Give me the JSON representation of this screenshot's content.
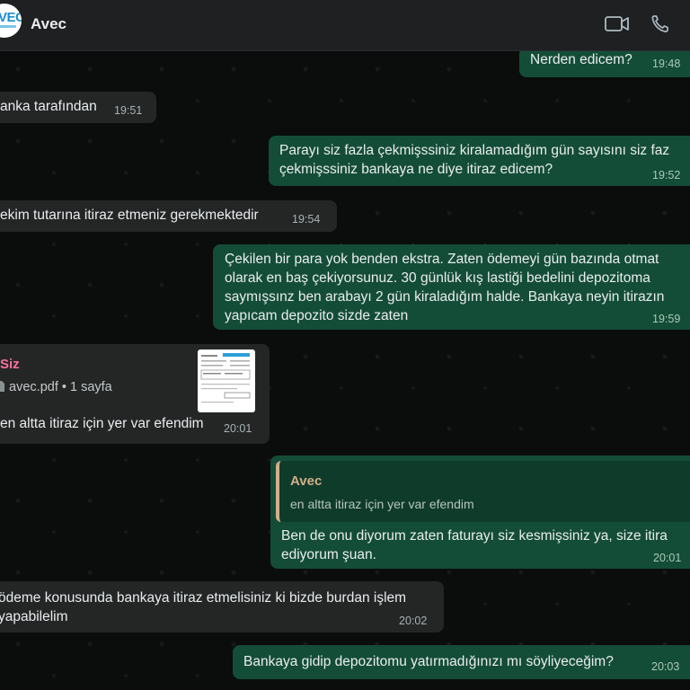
{
  "header": {
    "contact_name": "Avec",
    "avatar_text": "VEC",
    "icons": [
      "video-call-icon",
      "voice-call-icon"
    ]
  },
  "messages": [
    {
      "dir": "out",
      "lines": [
        "Nerden edicem?"
      ],
      "time": "19:48"
    },
    {
      "dir": "in",
      "lines": [
        "anka tarafından"
      ],
      "time": "19:51"
    },
    {
      "dir": "out",
      "lines": [
        "Parayı siz fazla çekmişssiniz kiralamadığım gün sayısını siz faz",
        "çekmişssiniz bankaya ne diye itiraz edicem?"
      ],
      "time": "19:52"
    },
    {
      "dir": "in",
      "lines": [
        "ekim tutarına itiraz etmeniz gerekmektedir"
      ],
      "time": "19:54"
    },
    {
      "dir": "out",
      "lines": [
        "Çekilen bir para yok benden ekstra. Zaten ödemeyi gün bazında otmat",
        "olarak en baş çekiyorsunuz. 30 günlük kış lastiği bedelini depozitoma",
        "saymışsınz ben arabayı 2 gün kiraladığım halde. Bankaya neyin itirazın",
        "yapıcam depozito sizde zaten"
      ],
      "time": "19:59"
    },
    {
      "dir": "in",
      "type": "document",
      "author": "Siz",
      "file_name": "avec.pdf",
      "file_pages": "1 sayfa",
      "lines": [
        "en altta itiraz için yer var efendim"
      ],
      "time": "20:01"
    },
    {
      "dir": "out",
      "type": "reply",
      "quote_author": "Avec",
      "quote_text": "en altta itiraz için yer var efendim",
      "lines": [
        "Ben de onu diyorum zaten faturayı siz kesmişsiniz ya, size itira",
        "ediyorum şuan."
      ],
      "time": "20:01"
    },
    {
      "dir": "in",
      "lines": [
        "ödeme konusunda bankaya itiraz etmelisiniz ki bizde burdan işlem",
        "yapabilelim"
      ],
      "time": "20:02"
    },
    {
      "dir": "out",
      "lines": [
        "Bankaya gidip depozitomu yatırmadığınızı mı söyliyeceğim?"
      ],
      "time": "20:03"
    }
  ]
}
